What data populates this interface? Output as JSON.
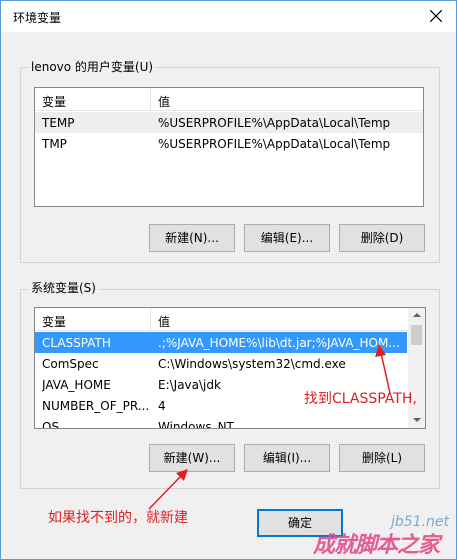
{
  "window": {
    "title": "环境变量"
  },
  "user_vars": {
    "legend": "lenovo 的用户变量(U)",
    "columns": [
      "变量",
      "值"
    ],
    "rows": [
      {
        "name": "TEMP",
        "value": "%USERPROFILE%\\AppData\\Local\\Temp"
      },
      {
        "name": "TMP",
        "value": "%USERPROFILE%\\AppData\\Local\\Temp"
      }
    ],
    "buttons": {
      "new": "新建(N)...",
      "edit": "编辑(E)...",
      "delete": "删除(D)"
    }
  },
  "system_vars": {
    "legend": "系统变量(S)",
    "columns": [
      "变量",
      "值"
    ],
    "rows": [
      {
        "name": "CLASSPATH",
        "value": ".;%JAVA_HOME%\\lib\\dt.jar;%JAVA_HOM..."
      },
      {
        "name": "ComSpec",
        "value": "C:\\Windows\\system32\\cmd.exe"
      },
      {
        "name": "JAVA_HOME",
        "value": "E:\\Java\\jdk"
      },
      {
        "name": "NUMBER_OF_PR...",
        "value": "4"
      },
      {
        "name": "OS",
        "value": "Windows_NT"
      }
    ],
    "buttons": {
      "new": "新建(W)...",
      "edit": "编辑(I)...",
      "delete": "删除(L)"
    }
  },
  "footer": {
    "ok": "确定"
  },
  "annotations": {
    "find_classpath": "找到CLASSPATH,",
    "create_if_missing": "如果找不到的，就新建"
  },
  "watermark": {
    "site": "jb51.net",
    "brand": "成就脚本之家"
  },
  "colors": {
    "selection": "#3399ff",
    "annotation": "#e02020",
    "default_button_border": "#0078d7"
  }
}
